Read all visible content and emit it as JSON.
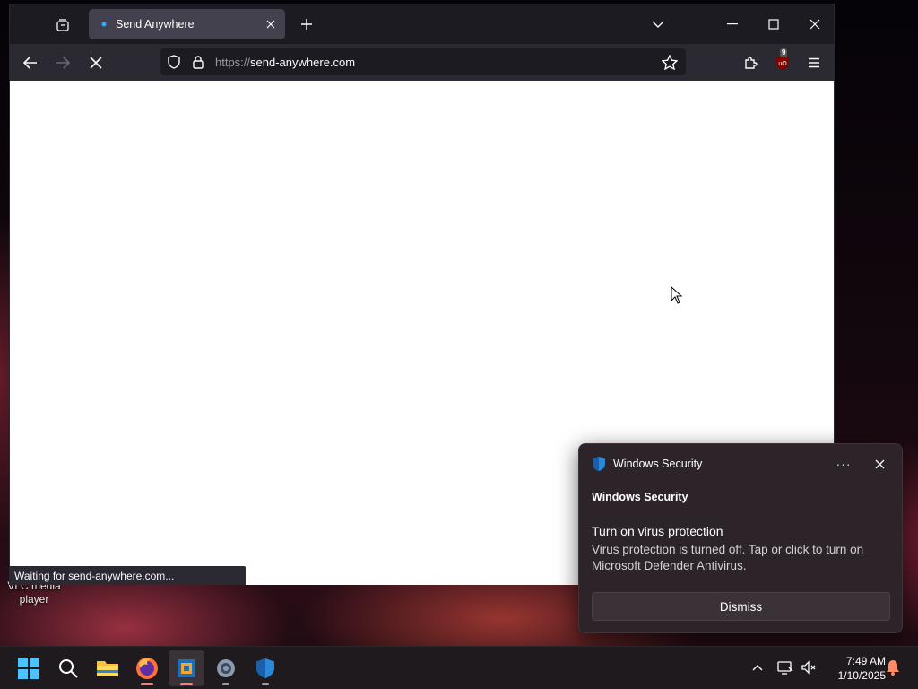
{
  "desktop": {
    "icon_label": "VLC media player"
  },
  "browser": {
    "tab": {
      "title": "Send Anywhere"
    },
    "url": {
      "protocol": "https://",
      "host": "send-anywhere.com"
    },
    "extension_badge": "9",
    "status_text": "Waiting for send-anywhere.com..."
  },
  "toast": {
    "header": "Windows Security",
    "app_name": "Windows Security",
    "title": "Turn on virus protection",
    "body": "Virus protection is turned off. Tap or click to turn on Microsoft Defender Antivirus.",
    "more_label": "···",
    "dismiss_label": "Dismiss"
  },
  "taskbar": {
    "apps": [
      "start-icon",
      "search-icon",
      "file-explorer-icon",
      "firefox-icon",
      "virtualbox-icon",
      "settings-icon",
      "windows-security-icon"
    ],
    "clock": {
      "time": "7:49 AM",
      "date": "1/10/2025"
    }
  },
  "colors": {
    "accent": "#0078d4",
    "chrome_bg": "#1c1b22",
    "toolbar_bg": "#2b2a33"
  }
}
